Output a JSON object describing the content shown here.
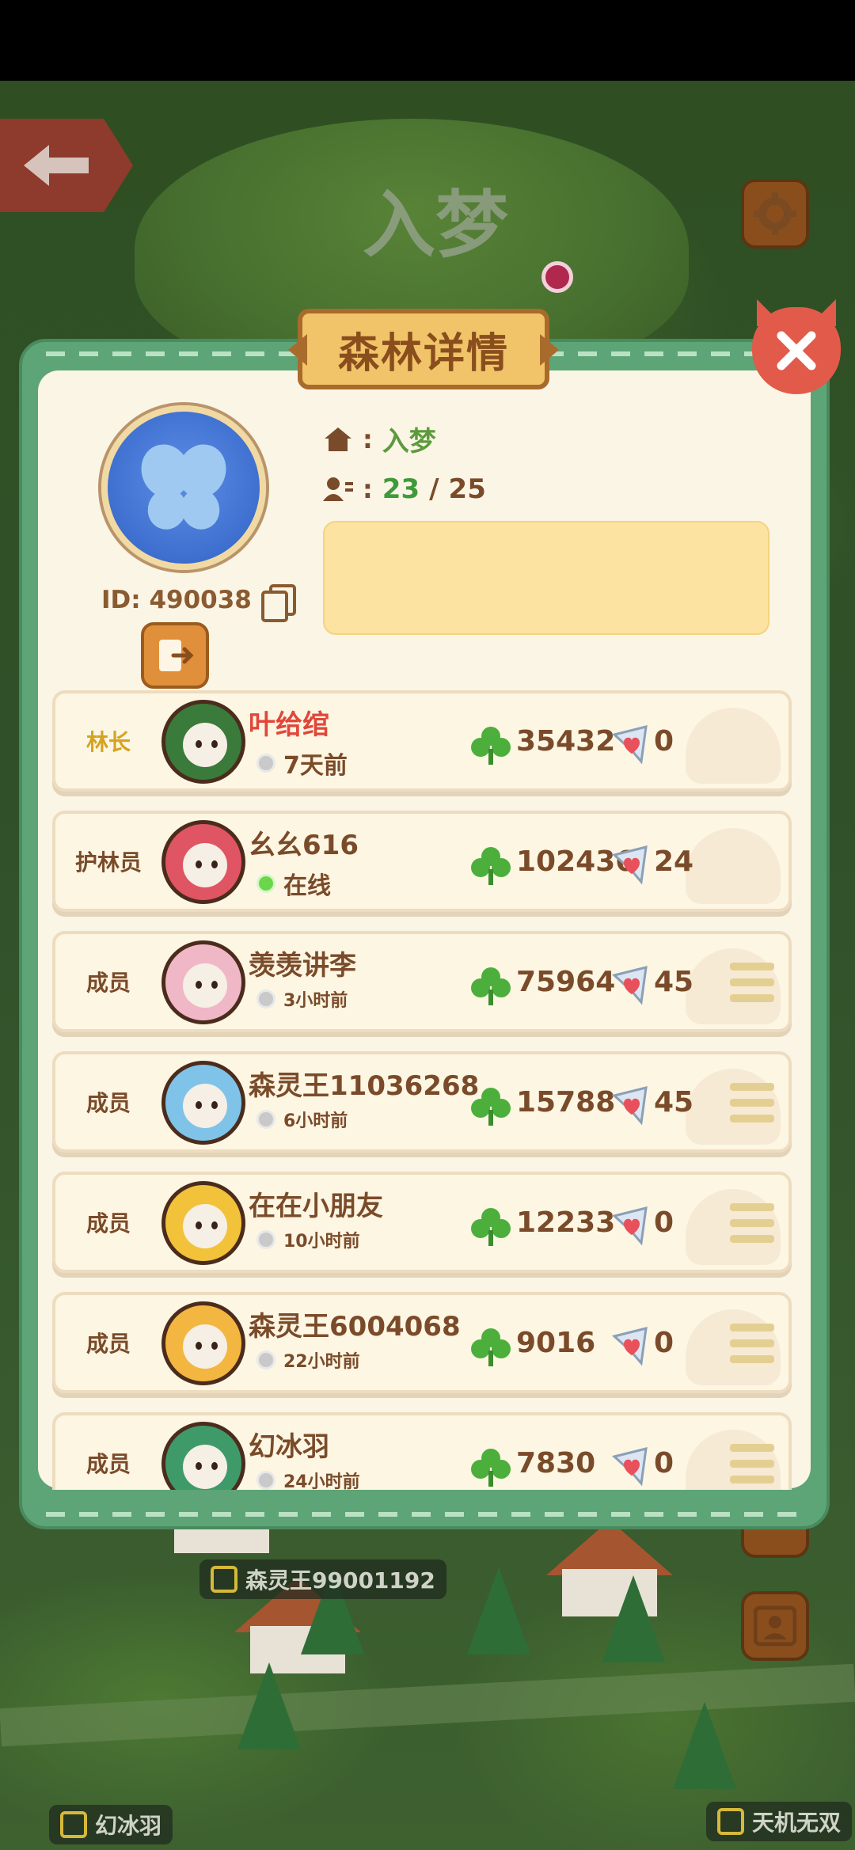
{
  "top_bar": {
    "title": "入梦"
  },
  "dialog": {
    "title": "森林详情",
    "forest": {
      "name": "入梦",
      "members_current": "23",
      "members_sep": "/",
      "members_max": "25",
      "id_label": "ID: 490038",
      "notice": ""
    },
    "members": [
      {
        "role": "林长",
        "name": "叶给绾",
        "status": "7天前",
        "online": false,
        "points": "35432",
        "likes": "0",
        "leader": true,
        "avatar_color": "#3a7a3a",
        "menu": false
      },
      {
        "role": "护林员",
        "name": "幺幺616",
        "status": "在线",
        "online": true,
        "points": "102436",
        "likes": "24",
        "leader": false,
        "avatar_color": "#e05563",
        "menu": false
      },
      {
        "role": "成员",
        "name": "羡羡讲李",
        "status": "3小时前",
        "online": false,
        "points": "75964",
        "likes": "45",
        "leader": false,
        "avatar_color": "#f0b7c7",
        "menu": true
      },
      {
        "role": "成员",
        "name": "森灵王11036268",
        "status": "6小时前",
        "online": false,
        "points": "15788",
        "likes": "45",
        "leader": false,
        "avatar_color": "#7fc3e8",
        "menu": true
      },
      {
        "role": "成员",
        "name": "在在小朋友",
        "status": "10小时前",
        "online": false,
        "points": "12233",
        "likes": "0",
        "leader": false,
        "avatar_color": "#f2c23a",
        "menu": true
      },
      {
        "role": "成员",
        "name": "森灵王6004068",
        "status": "22小时前",
        "online": false,
        "points": "9016",
        "likes": "0",
        "leader": false,
        "avatar_color": "#f3b640",
        "menu": true
      },
      {
        "role": "成员",
        "name": "幻冰羽",
        "status": "24小时前",
        "online": false,
        "points": "7830",
        "likes": "0",
        "leader": false,
        "avatar_color": "#3f9a6a",
        "menu": true
      }
    ]
  },
  "map_labels": [
    "森灵王99001192",
    "幻冰羽",
    "天机无双"
  ],
  "colors": {
    "frame_green": "#5da576",
    "panel_cream": "#fbf5e6",
    "brown_text": "#7a4b2a",
    "leader_red": "#e0473a",
    "gold": "#d6a320"
  },
  "icons": [
    "back-arrow-icon",
    "settings-gear-icon",
    "close-icon",
    "house-icon",
    "members-icon",
    "copy-icon",
    "exit-icon",
    "clover-icon",
    "heart-note-icon",
    "menu-icon",
    "profile-icon"
  ]
}
